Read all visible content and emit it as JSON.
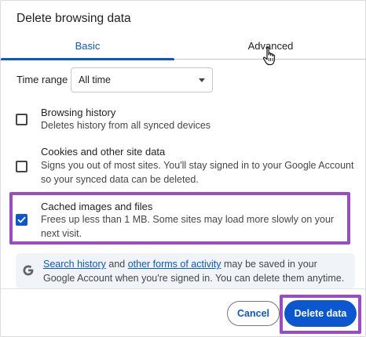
{
  "dialog": {
    "title": "Delete browsing data"
  },
  "tabs": [
    {
      "label": "Basic",
      "active": true
    },
    {
      "label": "Advanced",
      "active": false
    }
  ],
  "time_range": {
    "label": "Time range",
    "value": "All time"
  },
  "options": [
    {
      "title": "Browsing history",
      "description": "Deletes history from all synced devices",
      "checked": false
    },
    {
      "title": "Cookies and other site data",
      "description": "Signs you out of most sites. You'll stay signed in to your Google Account so your synced data can be deleted.",
      "checked": false
    },
    {
      "title": "Cached images and files",
      "description": "Frees up less than 1 MB. Some sites may load more slowly on your next visit.",
      "checked": true
    }
  ],
  "info": {
    "link1": "Search history",
    "text1": " and ",
    "link2": "other forms of activity",
    "text2": " may be saved in your Google Account when you're signed in. You can delete them anytime."
  },
  "buttons": {
    "cancel": "Cancel",
    "delete": "Delete data"
  },
  "colors": {
    "accent": "#0b57d0",
    "highlight": "#9b4bc4"
  }
}
